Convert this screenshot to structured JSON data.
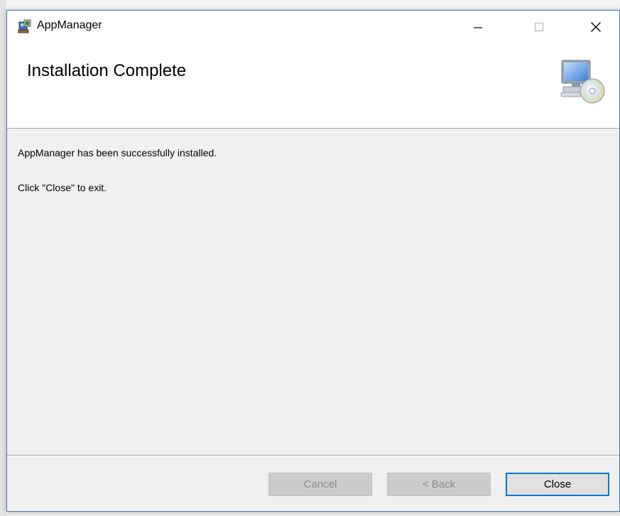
{
  "window": {
    "title": "AppManager",
    "controls": {
      "minimize_icon": "minimize-icon",
      "maximize_icon": "maximize-icon",
      "close_icon": "close-icon"
    }
  },
  "banner": {
    "title": "Installation Complete",
    "icon": "computer-cd-icon"
  },
  "messages": {
    "success": "AppManager has been successfully installed.",
    "instruction": "Click \"Close\" to exit."
  },
  "buttons": {
    "cancel": "Cancel",
    "back": "< Back",
    "close": "Close"
  },
  "colors": {
    "accent": "#0078d7",
    "disabled_bg": "#cccccc",
    "disabled_text": "#8a8a8a",
    "dialog_bg": "#f0f0f0"
  }
}
